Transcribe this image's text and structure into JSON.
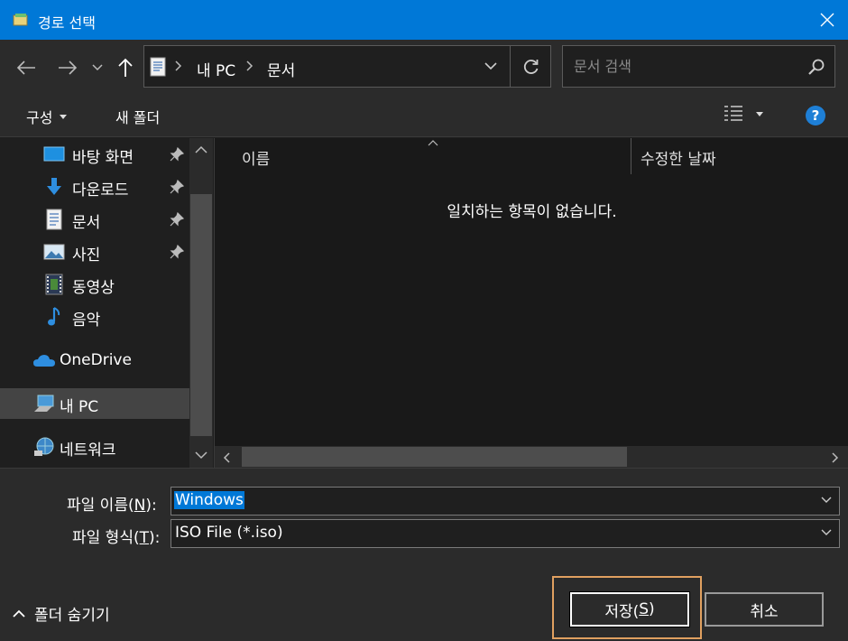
{
  "window": {
    "title": "경로 선택",
    "accent": "#0078d7"
  },
  "address_bar": {
    "crumbs": [
      "내 PC",
      "문서"
    ],
    "icon": "document-icon"
  },
  "search": {
    "placeholder": "문서 검색"
  },
  "toolbar": {
    "organize_label": "구성",
    "new_folder_label": "새 폴더"
  },
  "nav_pane": {
    "items": [
      {
        "label": "바탕 화면",
        "icon": "desktop-icon",
        "pinned": true
      },
      {
        "label": "다운로드",
        "icon": "download-icon",
        "pinned": true
      },
      {
        "label": "문서",
        "icon": "document-icon",
        "pinned": true
      },
      {
        "label": "사진",
        "icon": "pictures-icon",
        "pinned": true
      },
      {
        "label": "동영상",
        "icon": "video-icon",
        "pinned": false
      },
      {
        "label": "음악",
        "icon": "music-icon",
        "pinned": false
      },
      {
        "label": "OneDrive",
        "icon": "onedrive-icon",
        "pinned": false
      },
      {
        "label": "내 PC",
        "icon": "computer-icon",
        "pinned": false,
        "selected": true
      },
      {
        "label": "네트워크",
        "icon": "network-icon",
        "pinned": false
      }
    ]
  },
  "file_list": {
    "columns": [
      "이름",
      "수정한 날짜"
    ],
    "empty_message": "일치하는 항목이 없습니다."
  },
  "form": {
    "filename_label": "파일 이름(",
    "filename_hotkey": "N",
    "filename_suffix": "):",
    "filename_value": "Windows",
    "filetype_label": "파일 형식(",
    "filetype_hotkey": "T",
    "filetype_suffix": "):",
    "filetype_value": "ISO File (*.iso)"
  },
  "footer": {
    "hide_folders_label": "폴더 숨기기",
    "save_label": "저장(",
    "save_hotkey": "S",
    "save_suffix": ")",
    "cancel_label": "취소"
  }
}
